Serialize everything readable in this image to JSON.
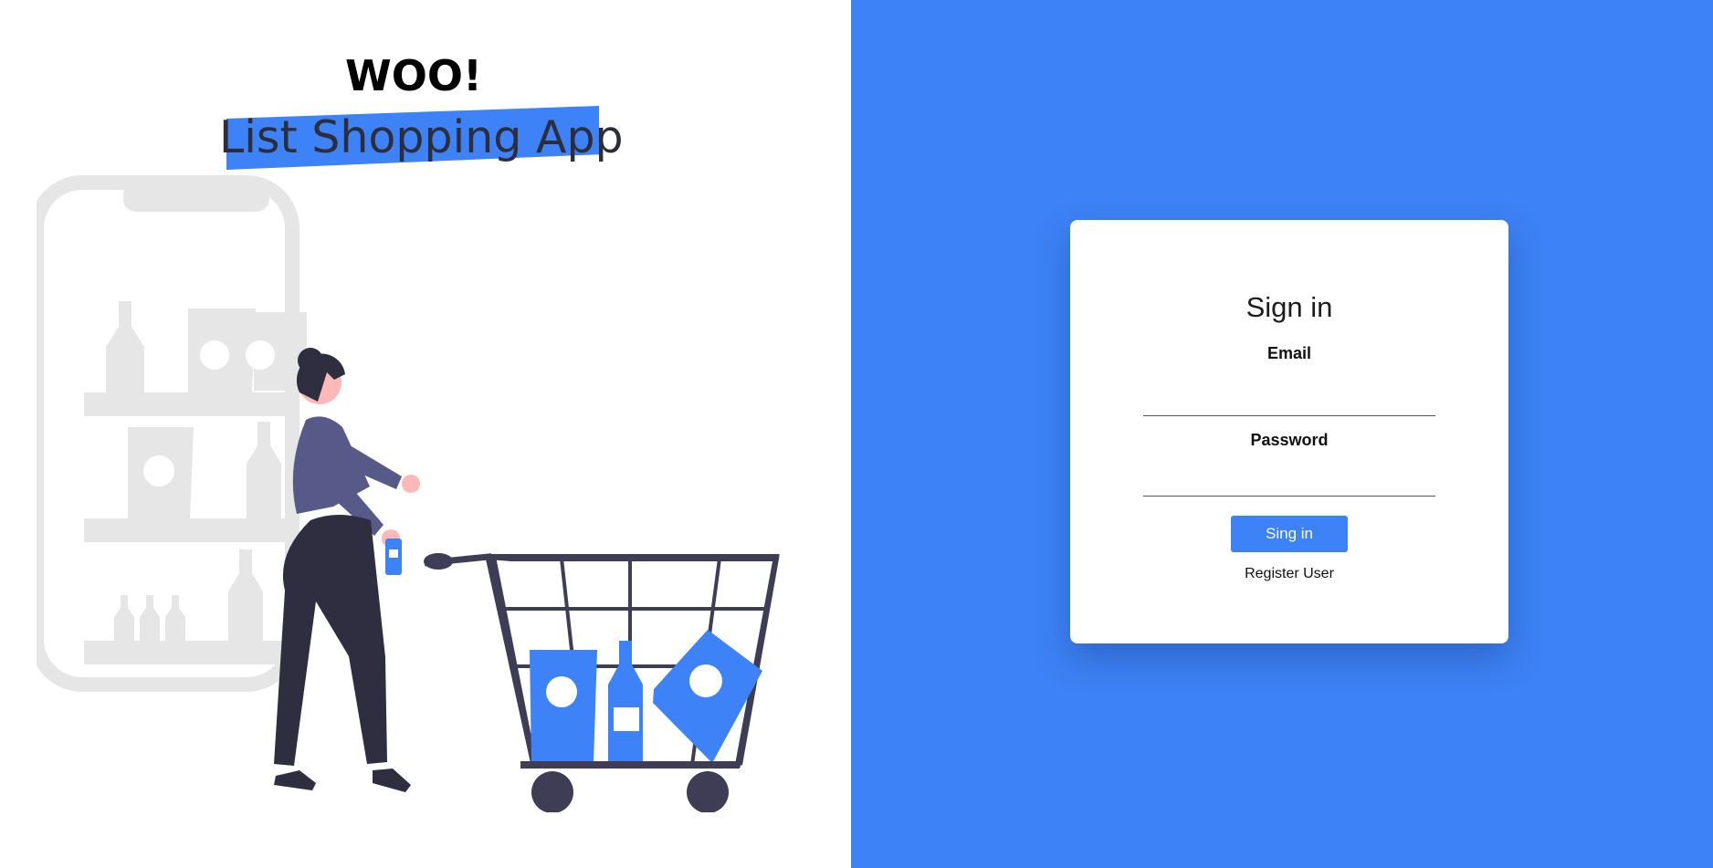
{
  "brand": {
    "title": "WOO!",
    "subtitle": "List Shopping App",
    "accent_color": "#3d82f6"
  },
  "illustration": {
    "subject": "woman-with-shopping-cart-icon",
    "background": "phone-with-shelves-icon"
  },
  "login": {
    "title": "Sign in",
    "email_label": "Email",
    "email_value": "",
    "password_label": "Password",
    "password_value": "",
    "submit_label": "Sing in",
    "register_label": "Register User"
  },
  "colors": {
    "right_panel_bg": "#3d82f6",
    "card_bg": "#ffffff",
    "text": "#111111"
  }
}
